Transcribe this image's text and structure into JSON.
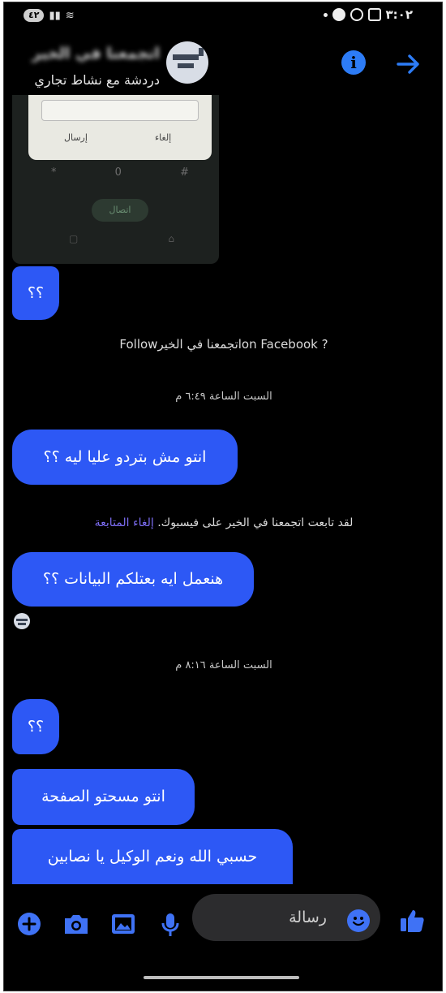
{
  "status_bar": {
    "battery": "٤٢",
    "time": "٣:٠٢"
  },
  "header": {
    "page_name": "اتجمعنا في الخير",
    "subtitle": "دردشة مع نشاط تجاري"
  },
  "shared_image": {
    "dialog_send": "إرسال",
    "dialog_cancel": "إلغاء",
    "keys": [
      "*",
      "0",
      "#"
    ],
    "call_label": "اتصال"
  },
  "messages": {
    "m1": "؟؟",
    "follow_prompt": "Followاتجمعنا في الخيرon Facebook ?",
    "ts1": "السبت الساعة ٦:٤٩ م",
    "m2": "انتو مش بتردو عليا ليه ؟؟",
    "follow_notice": "لقد تابعت اتجمعنا في الخير على فيسبوك.",
    "unfollow_link": "إلغاء المتابعة",
    "m3": "هنعمل ايه بعتلكم البيانات ؟؟",
    "ts2": "السبت الساعة ٨:١٦ م",
    "m4": "؟؟",
    "m5": "انتو مسحتو الصفحة",
    "m6": "حسبي الله ونعم الوكيل يا نصابين"
  },
  "composer": {
    "placeholder": "رسالة"
  },
  "colors": {
    "bubble": "#2d58f5",
    "accent": "#2d7cf6",
    "background": "#000000"
  },
  "icons": [
    "back-arrow-icon",
    "info-icon",
    "plus-icon",
    "camera-icon",
    "gallery-icon",
    "microphone-icon",
    "emoji-icon",
    "like-icon"
  ]
}
